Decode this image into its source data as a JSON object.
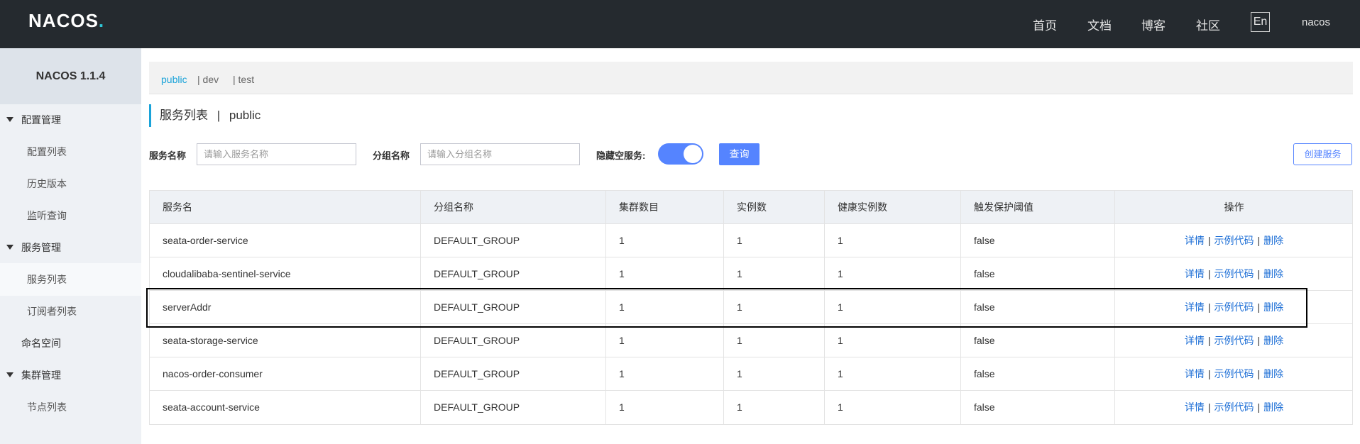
{
  "header": {
    "logo": "NACOS",
    "nav": [
      "首页",
      "文档",
      "博客",
      "社区"
    ],
    "lang_button": "En",
    "user": "nacos"
  },
  "sidebar": {
    "title": "NACOS 1.1.4",
    "items": [
      {
        "label": "配置管理",
        "type": "group"
      },
      {
        "label": "配置列表",
        "type": "sub"
      },
      {
        "label": "历史版本",
        "type": "sub"
      },
      {
        "label": "监听查询",
        "type": "sub"
      },
      {
        "label": "服务管理",
        "type": "group"
      },
      {
        "label": "服务列表",
        "type": "sub",
        "active": true
      },
      {
        "label": "订阅者列表",
        "type": "sub"
      },
      {
        "label": "命名空间",
        "type": "plain"
      },
      {
        "label": "集群管理",
        "type": "group"
      },
      {
        "label": "节点列表",
        "type": "sub"
      }
    ]
  },
  "namespaces": {
    "items": [
      "public",
      "| dev",
      "| test"
    ],
    "active": "public"
  },
  "page": {
    "title": "服务列表",
    "separator": "|",
    "namespace": "public"
  },
  "filters": {
    "service_name_label": "服务名称",
    "service_name_placeholder": "请输入服务名称",
    "group_name_label": "分组名称",
    "group_name_placeholder": "请输入分组名称",
    "hide_empty_label": "隐藏空服务:",
    "hide_empty_value": true,
    "query_button": "查询",
    "create_button": "创建服务"
  },
  "table": {
    "columns": [
      "服务名",
      "分组名称",
      "集群数目",
      "实例数",
      "健康实例数",
      "触发保护阈值",
      "操作"
    ],
    "rows": [
      [
        "seata-order-service",
        "DEFAULT_GROUP",
        "1",
        "1",
        "1",
        "false"
      ],
      [
        "cloudalibaba-sentinel-service",
        "DEFAULT_GROUP",
        "1",
        "1",
        "1",
        "false"
      ],
      [
        "serverAddr",
        "DEFAULT_GROUP",
        "1",
        "1",
        "1",
        "false"
      ],
      [
        "seata-storage-service",
        "DEFAULT_GROUP",
        "1",
        "1",
        "1",
        "false"
      ],
      [
        "nacos-order-consumer",
        "DEFAULT_GROUP",
        "1",
        "1",
        "1",
        "false"
      ],
      [
        "seata-account-service",
        "DEFAULT_GROUP",
        "1",
        "1",
        "1",
        "false"
      ]
    ],
    "actions": [
      "详情",
      "示例代码",
      "删除"
    ],
    "highlighted_row": "serverAddr"
  },
  "colors": {
    "topbar": "#252a2f",
    "accent": "#5584ff",
    "link": "#1c6ed6",
    "ns_active": "#1aa3d9"
  }
}
